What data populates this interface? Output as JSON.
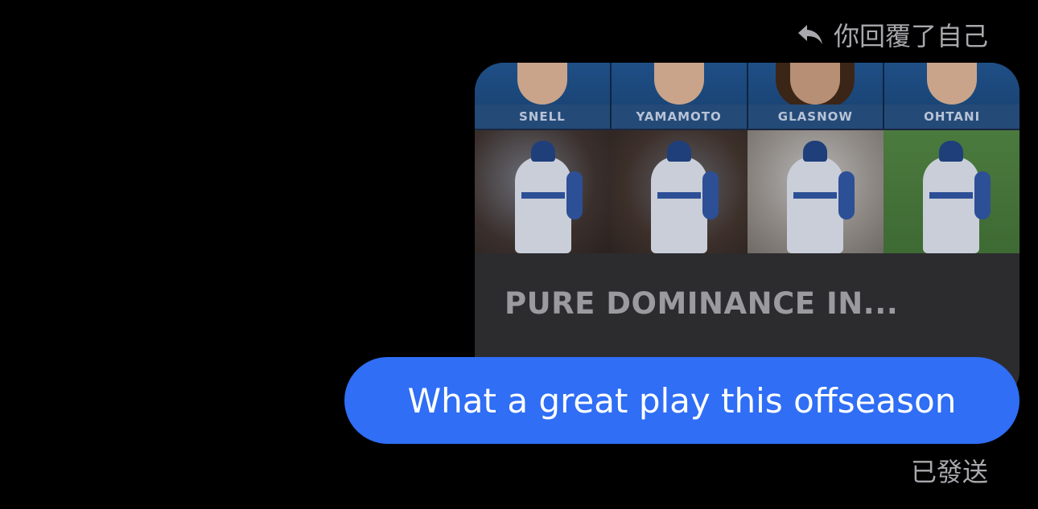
{
  "reply_header": {
    "icon": "reply-arrow-icon",
    "label": "你回覆了自己"
  },
  "shared_post": {
    "player_names": [
      "SNELL",
      "YAMAMOTO",
      "GLASNOW",
      "OHTANI"
    ],
    "caption": "PURE DOMINANCE IN..."
  },
  "message": {
    "text": "What a great play this offseason",
    "bubble_color": "#2f6ef5"
  },
  "status": "已發送"
}
